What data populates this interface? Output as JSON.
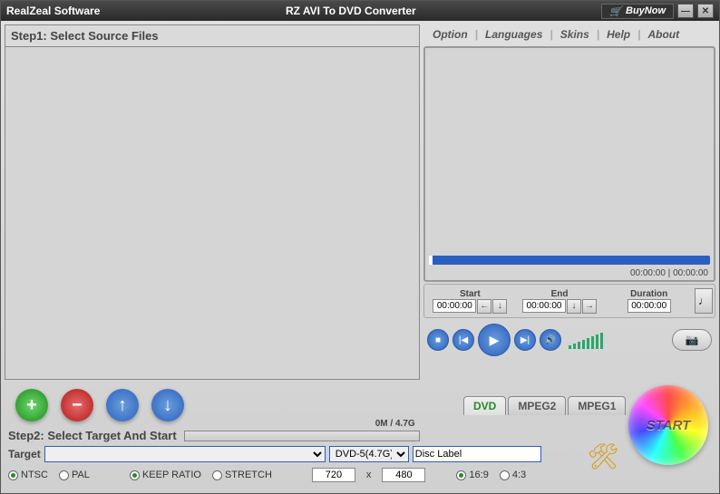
{
  "titlebar": {
    "brand": "RealZeal Software",
    "title": "RZ AVI To DVD Converter",
    "buynow": "BuyNow"
  },
  "menubar": {
    "option": "Option",
    "languages": "Languages",
    "skins": "Skins",
    "help": "Help",
    "about": "About"
  },
  "step1": {
    "label": "Step1: Select Source Files"
  },
  "preview": {
    "time_left": "00:00:00",
    "time_right": "00:00:00"
  },
  "trim": {
    "start_label": "Start",
    "start_value": "00:00:00",
    "end_label": "End",
    "end_value": "00:00:00",
    "duration_label": "Duration",
    "duration_value": "00:00:00"
  },
  "tabs": {
    "dvd": "DVD",
    "mpeg2": "MPEG2",
    "mpeg1": "MPEG1"
  },
  "step2": {
    "label": "Step2: Select Target And Start",
    "progress": "0M / 4.7G"
  },
  "target": {
    "label": "Target",
    "size_selected": "DVD-5(4.7G)",
    "disc_label": "Disc Label"
  },
  "settings": {
    "ntsc": "NTSC",
    "pal": "PAL",
    "keep_ratio": "KEEP RATIO",
    "stretch": "STRETCH",
    "width": "720",
    "x": "x",
    "height": "480",
    "r169": "16:9",
    "r43": "4:3"
  },
  "start": {
    "label": "START"
  }
}
